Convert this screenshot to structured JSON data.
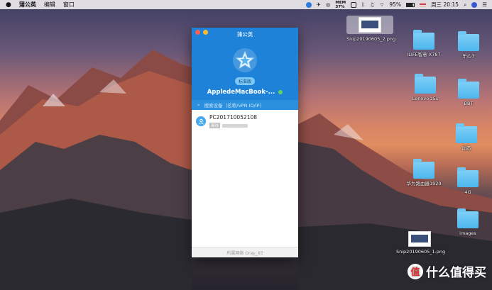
{
  "menubar": {
    "app_name": "蒲公英",
    "menus": [
      "编辑",
      "窗口"
    ],
    "status_icons": [
      "pgy-tray-icon",
      "airplane-icon",
      "podcast-icon",
      "memory-icon",
      "cpu-icon",
      "bluetooth-icon",
      "headphone-icon",
      "wifi-icon",
      "battery-icon"
    ],
    "memory_label": "MEM",
    "memory_value": "37%",
    "battery_percent": "95%",
    "clock": "周三 20:15"
  },
  "window": {
    "title": "蒲公英",
    "edition_badge": "标准版",
    "device_name": "AppledeMacBook-...",
    "search_placeholder": "搜索设备（名称/VPN ID/IP）",
    "devices": [
      {
        "name": "PC201710052108",
        "status": "离线"
      }
    ],
    "footer": "所属网络 Oray_X5"
  },
  "desktop": {
    "items": [
      {
        "label": "Snip20190605_2.png",
        "kind": "image"
      },
      {
        "label": "ILIFE智意 X787",
        "kind": "folder"
      },
      {
        "label": "乐心3",
        "kind": "folder"
      },
      {
        "label": "Lenovo z5s",
        "kind": "folder"
      },
      {
        "label": "BBT",
        "kind": "folder"
      },
      {
        "label": "动态",
        "kind": "folder"
      },
      {
        "label": "华为路由器1920",
        "kind": "folder"
      },
      {
        "label": "4G",
        "kind": "folder"
      },
      {
        "label": "images",
        "kind": "folder"
      },
      {
        "label": "Snip20190605_1.png",
        "kind": "image"
      }
    ]
  },
  "watermark": {
    "text": "什么值得买",
    "badge": "值"
  },
  "colors": {
    "accent": "#1e83d8",
    "folder": "#4db6ee",
    "online": "#5fd35c"
  }
}
